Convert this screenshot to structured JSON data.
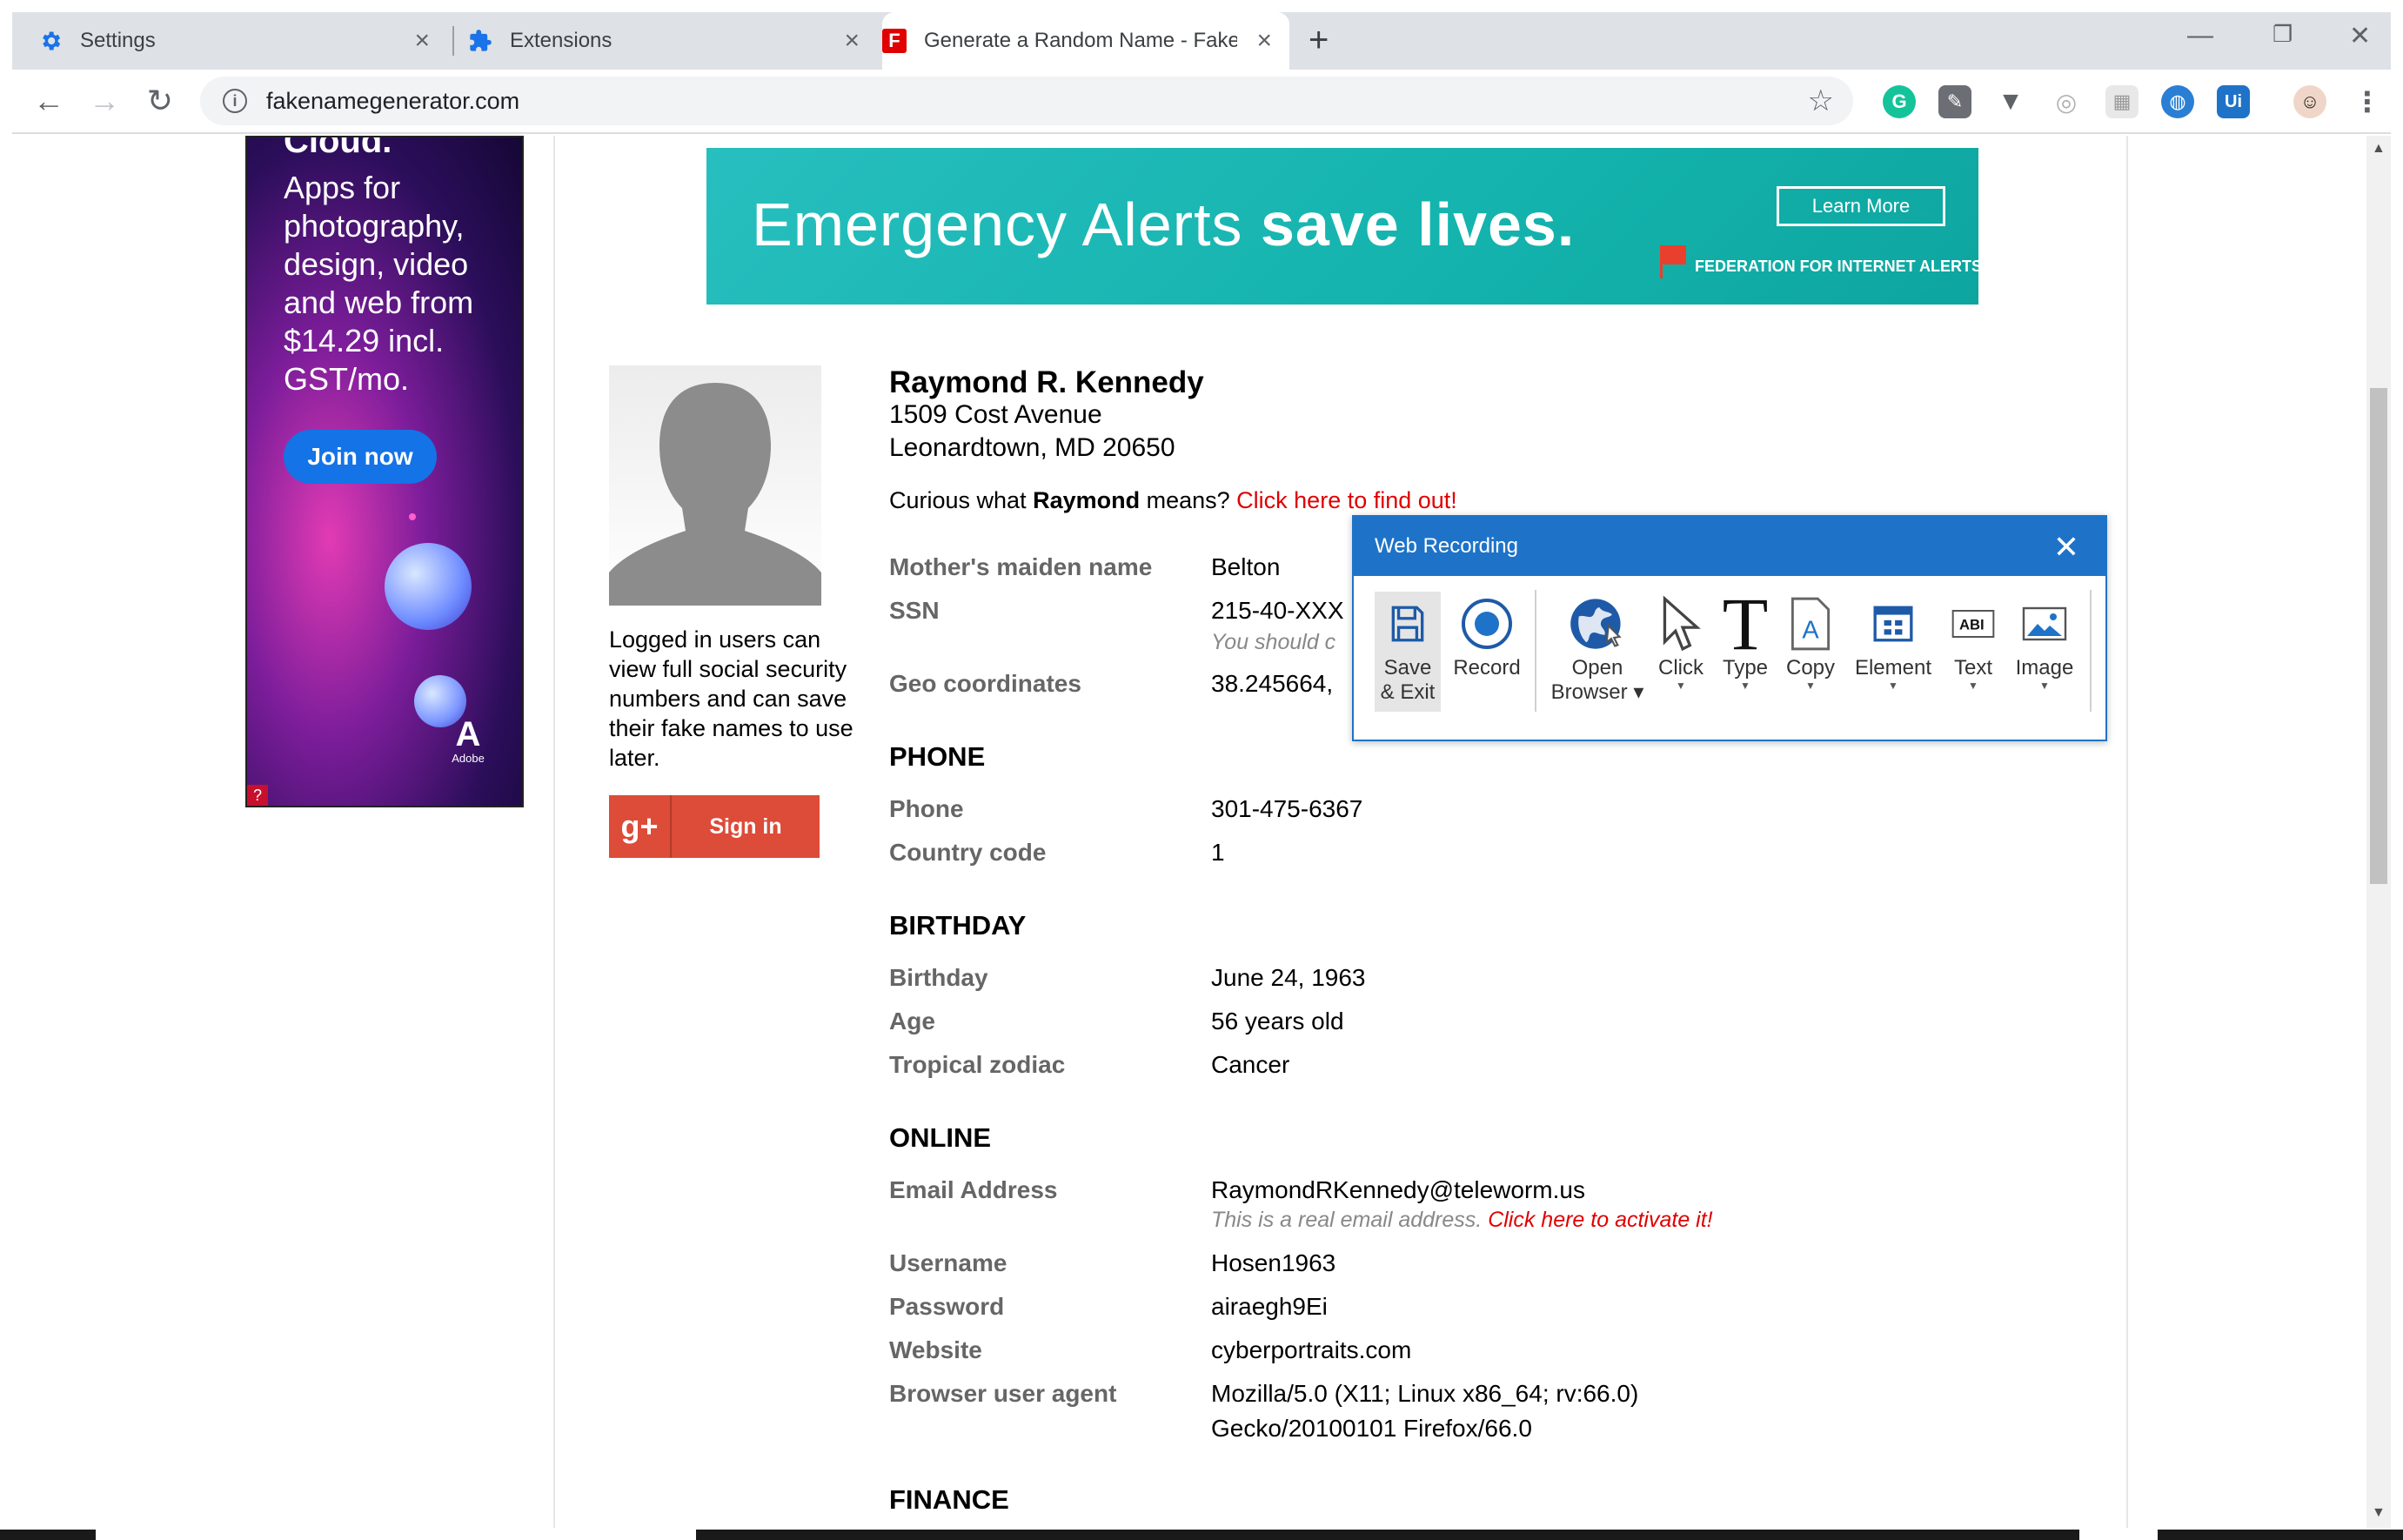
{
  "tabs": [
    {
      "label": "Settings",
      "icon": "gear-icon"
    },
    {
      "label": "Extensions",
      "icon": "puzzle-icon"
    },
    {
      "label": "Generate a Random Name - Fake",
      "icon": "fakename-favicon",
      "favicon_text": "F"
    }
  ],
  "address_bar": {
    "url": "fakenamegenerator.com"
  },
  "left_ad": {
    "title": "Cloud.",
    "text": "Apps for photography, design, video and web from $14.29 incl. GST/mo.",
    "button": "Join now",
    "brand": "Adobe",
    "adchoice": "?"
  },
  "banner": {
    "text_light": "Emergency Alerts ",
    "text_bold": "save lives.",
    "button": "Learn More",
    "org": "FEDERATION FOR INTERNET ALERTS"
  },
  "side": {
    "note": "Logged in users can view full social security numbers and can save their fake names to use later.",
    "gplus": "g+",
    "sign_in": "Sign in"
  },
  "person": {
    "name": "Raymond R. Kennedy",
    "address1": "1509 Cost Avenue",
    "address2": "Leonardtown, MD 20650",
    "curious_pre": "Curious what ",
    "first_name": "Raymond",
    "curious_post": " means? ",
    "curious_link": "Click here to find out!"
  },
  "fields": {
    "maiden_label": "Mother's maiden name",
    "maiden": "Belton",
    "ssn_label": "SSN",
    "ssn": "215-40-XXX",
    "ssn_note": "You should c",
    "geo_label": "Geo coordinates",
    "geo": "38.245664,",
    "phone_section": "PHONE",
    "phone_label": "Phone",
    "phone": "301-475-6367",
    "cc_label": "Country code",
    "cc": "1",
    "birthday_section": "BIRTHDAY",
    "birthday_label": "Birthday",
    "birthday": "June 24, 1963",
    "age_label": "Age",
    "age": "56 years old",
    "zodiac_label": "Tropical zodiac",
    "zodiac": "Cancer",
    "online_section": "ONLINE",
    "email_label": "Email Address",
    "email": "RaymondRKennedy@teleworm.us",
    "email_note": "This is a real email address. ",
    "email_link": "Click here to activate it!",
    "username_label": "Username",
    "username": "Hosen1963",
    "password_label": "Password",
    "password": "airaegh9Ei",
    "website_label": "Website",
    "website": "cyberportraits.com",
    "ua_label": "Browser user agent",
    "ua1": "Mozilla/5.0 (X11; Linux x86_64; rv:66.0)",
    "ua2": "Gecko/20100101 Firefox/66.0",
    "finance_section": "FINANCE"
  },
  "recording": {
    "title": "Web Recording",
    "save_exit_1": "Save",
    "save_exit_2": "& Exit",
    "record": "Record",
    "open_browser_1": "Open",
    "open_browser_2": "Browser",
    "click": "Click",
    "type": "Type",
    "copy": "Copy",
    "element": "Element",
    "text": "Text",
    "image": "Image"
  },
  "colors": {
    "link_red": "#e00000",
    "label_gray": "#666666",
    "recording_blue": "#1e73c8",
    "banner_teal": "#14b3ad",
    "gplus_red": "#dd4b39"
  }
}
